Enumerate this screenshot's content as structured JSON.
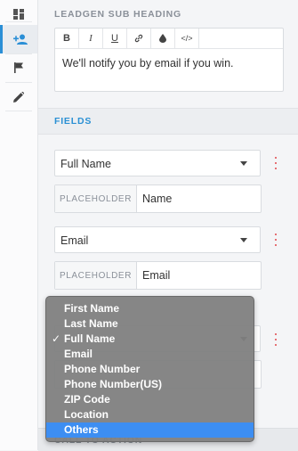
{
  "sidebar": {
    "items": [
      {
        "name": "dashboard-icon",
        "active": false
      },
      {
        "name": "add-user-icon",
        "active": true
      },
      {
        "name": "flag-icon",
        "active": false
      },
      {
        "name": "pencil-icon",
        "active": false
      }
    ],
    "accent_color": "#2b8fd6"
  },
  "sub_heading": {
    "label": "LEADGEN SUB HEADING",
    "toolbar": [
      "B",
      "I",
      "U",
      "link-icon",
      "drop-icon",
      "code-icon"
    ],
    "text": "We'll notify you by email if you win."
  },
  "fields_section": {
    "title": "FIELDS",
    "fields": [
      {
        "type": "Full Name",
        "placeholder_label": "PLACEHOLDER",
        "placeholder_value": "Name"
      },
      {
        "type": "Email",
        "placeholder_label": "PLACEHOLDER",
        "placeholder_value": "Email"
      }
    ],
    "title_color": "#2a90d4",
    "kebab_color": "#e0454a"
  },
  "bottom_section": {
    "title": "CALL TO ACTION"
  },
  "dropdown": {
    "options": [
      "First Name",
      "Last Name",
      "Full Name",
      "Email",
      "Phone Number",
      "Phone Number(US)",
      "ZIP Code",
      "Location",
      "Others"
    ],
    "checked": "Full Name",
    "highlighted": "Others",
    "check_glyph": "✓",
    "highlight_color": "#3d8ef2"
  }
}
